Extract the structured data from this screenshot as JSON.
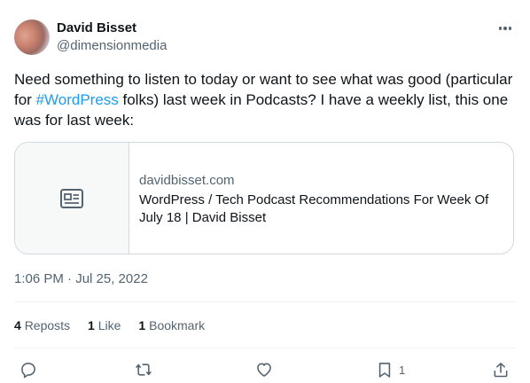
{
  "author": {
    "name": "David Bisset",
    "handle": "@dimensionmedia"
  },
  "tweet": {
    "text_before": "Need something to listen to today or want to see what was good (particular for ",
    "hashtag": "#WordPress",
    "text_after": " folks) last week in Podcasts? I have a weekly list, this one was for last week:"
  },
  "card": {
    "domain": "davidbisset.com",
    "title": "WordPress / Tech Podcast Recommendations For Week Of July 18 | David Bisset"
  },
  "timestamp": "1:06 PM · Jul 25, 2022",
  "stats": {
    "reposts_count": "4",
    "reposts_label": "Reposts",
    "likes_count": "1",
    "likes_label": "Like",
    "bookmarks_count": "1",
    "bookmarks_label": "Bookmark"
  },
  "actions": {
    "bookmark_count": "1"
  },
  "icons": {
    "more": "more-horizontal-icon",
    "card_thumb": "article-icon",
    "reply": "reply-icon",
    "repost": "repost-icon",
    "like": "heart-icon",
    "bookmark": "bookmark-icon",
    "share": "share-icon"
  },
  "colors": {
    "link": "#1d9bf0",
    "secondary_text": "#536471",
    "border": "#cfd9de"
  }
}
